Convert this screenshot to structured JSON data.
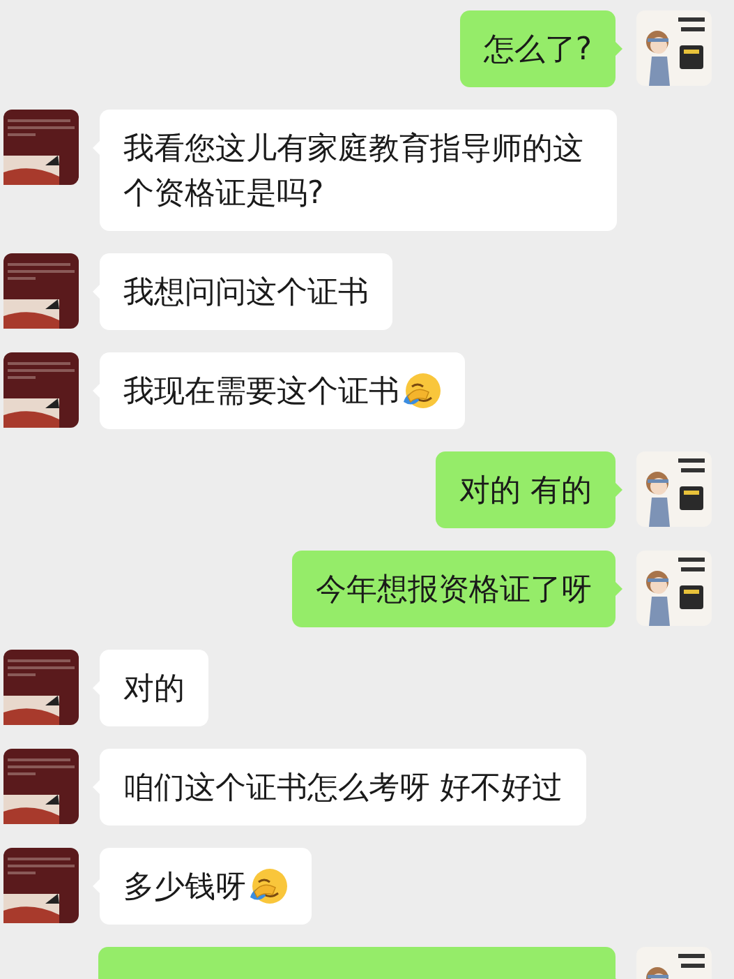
{
  "messages": [
    {
      "kind": "sent",
      "text": "怎么了?"
    },
    {
      "kind": "received",
      "text": "我看您这儿有家庭教育指导师的这个资格证是吗?"
    },
    {
      "kind": "received",
      "text": "我想问问这个证书"
    },
    {
      "kind": "received",
      "text": "我现在需要这个证书",
      "emoji": true
    },
    {
      "kind": "sent",
      "text": "对的 有的"
    },
    {
      "kind": "sent",
      "text": "今年想报资格证了呀"
    },
    {
      "kind": "received",
      "text": "对的"
    },
    {
      "kind": "received",
      "text": "咱们这个证书怎么考呀 好不好过"
    },
    {
      "kind": "received",
      "text": "多少钱呀",
      "emoji": true
    },
    {
      "kind": "sent"
    }
  ]
}
